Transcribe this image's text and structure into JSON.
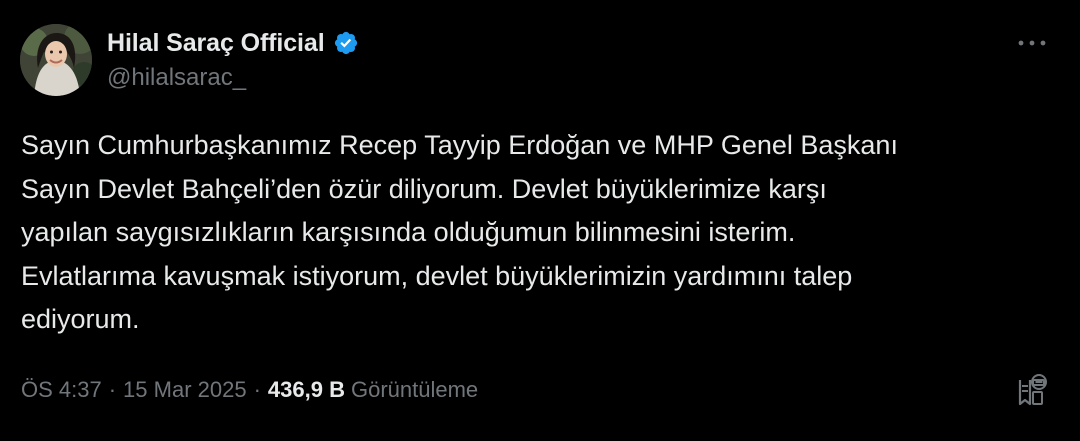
{
  "author": {
    "display_name": "Hilal Saraç Official",
    "handle": "@hilalsarac_",
    "verified": true
  },
  "tweet": {
    "text": "Sayın Cumhurbaşkanımız Recep Tayyip Erdoğan ve MHP Genel Başkanı\nSayın Devlet Bahçeli’den özür diliyorum. Devlet büyüklerimize karşı\nyapılan saygısızlıkların karşısında olduğumun bilinmesini isterim.\nEvlatlarıma kavuşmak istiyorum, devlet büyüklerimizin yardımını talep\nediyorum."
  },
  "meta": {
    "time": "ÖS 4:37",
    "separator": "·",
    "date": "15 Mar 2025",
    "views_count": "436,9 B",
    "views_label": "Görüntüleme"
  },
  "icons": {
    "verified": "verified-badge-icon",
    "more": "more-horizontal-icon",
    "action": "bookmark-list-icon"
  },
  "colors": {
    "background": "#000000",
    "text_primary": "#e7e9ea",
    "text_secondary": "#71767b",
    "verified_blue": "#1d9bf0"
  }
}
